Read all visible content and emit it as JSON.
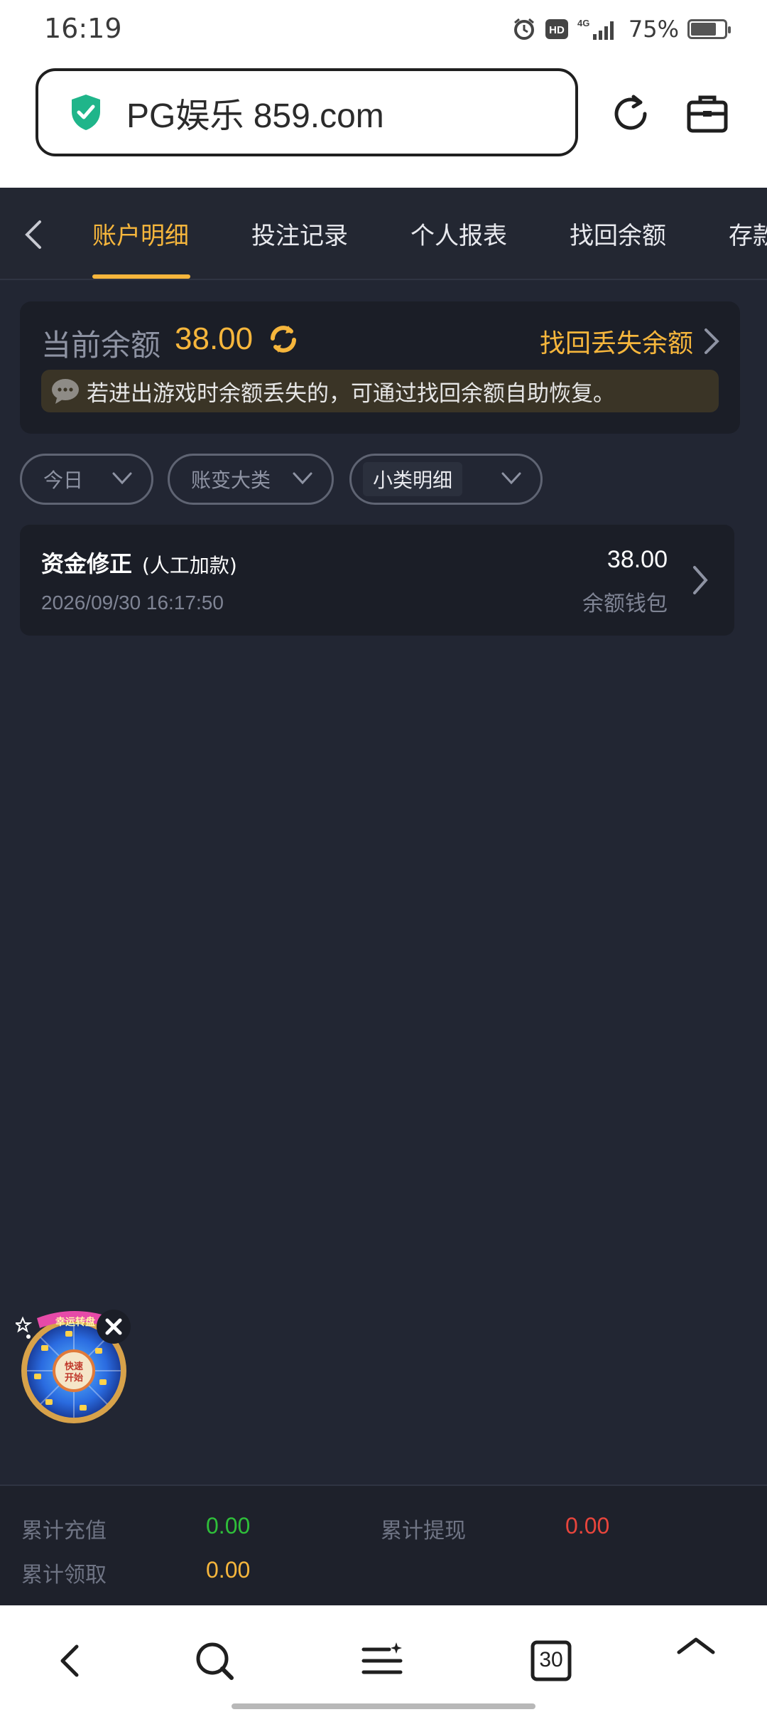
{
  "status_bar": {
    "time": "16:19",
    "network": "4G",
    "battery": "75%",
    "battery_level": 0.75
  },
  "browser": {
    "url": "PG娱乐 859.com"
  },
  "tabs": [
    {
      "label": "账户明细",
      "active": true
    },
    {
      "label": "投注记录",
      "active": false
    },
    {
      "label": "个人报表",
      "active": false
    },
    {
      "label": "找回余额",
      "active": false
    },
    {
      "label": "存款",
      "active": false
    }
  ],
  "balance": {
    "label": "当前余额",
    "value": "38.00",
    "recover_label": "找回丢失余额",
    "notice": "若进出游戏时余额丢失的，可通过找回余额自助恢复。"
  },
  "filters": [
    {
      "label": "今日"
    },
    {
      "label": "账变大类"
    },
    {
      "label": "小类明细"
    }
  ],
  "records": [
    {
      "title": "资金修正",
      "subtitle": "(人工加款)",
      "time": "2026/09/30 16:17:50",
      "amount": "38.00",
      "wallet": "余额钱包"
    }
  ],
  "widget": {
    "title": "幸运转盘",
    "center": "快速开始"
  },
  "summary": {
    "recharge_label": "累计充值",
    "recharge_value": "0.00",
    "withdraw_label": "累计提现",
    "withdraw_value": "0.00",
    "claim_label": "累计领取",
    "claim_value": "0.00"
  },
  "nav": {
    "tabs_count": "30"
  },
  "colors": {
    "accent": "#f6b63c",
    "background": "#222633",
    "green": "#2fbf3a",
    "red": "#e8453c"
  }
}
